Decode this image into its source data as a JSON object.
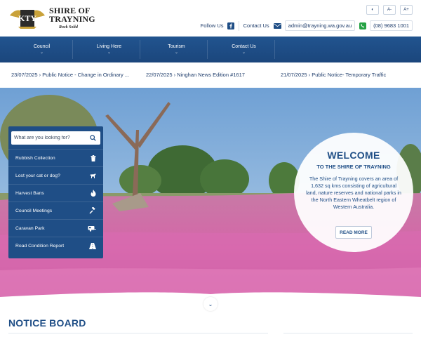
{
  "site": {
    "title_line1": "SHIRE OF",
    "title_line2": "TRAYNING",
    "motto": "Rock Solid"
  },
  "accessibility": [
    {
      "label": "◐"
    },
    {
      "label": "A-"
    },
    {
      "label": "A+"
    }
  ],
  "contact": {
    "follow_label": "Follow Us",
    "contact_label": "Contact Us",
    "email": "admin@trayning.wa.gov.au",
    "phone": "(08) 9683 1001"
  },
  "nav": [
    {
      "label": "Council"
    },
    {
      "label": "Living Here"
    },
    {
      "label": "Tourism"
    },
    {
      "label": "Contact Us"
    }
  ],
  "notices": [
    {
      "date": "23/07/2025",
      "text": "Public Notice - Change in Ordinary ..."
    },
    {
      "date": "22/07/2025",
      "text": "Ninghan News Edition #1617"
    },
    {
      "date": "21/07/2025",
      "text": "Public Notice- Temporary Traffic"
    }
  ],
  "search": {
    "placeholder": "What are you looking for?"
  },
  "quick_links": [
    {
      "label": "Rubbish Collection",
      "icon": "trash-icon"
    },
    {
      "label": "Lost your cat or dog?",
      "icon": "dog-icon"
    },
    {
      "label": "Harvest Bans",
      "icon": "fire-icon"
    },
    {
      "label": "Council Meetings",
      "icon": "gavel-icon"
    },
    {
      "label": "Caravan Park",
      "icon": "caravan-icon"
    },
    {
      "label": "Road Condition Report",
      "icon": "road-icon"
    }
  ],
  "welcome": {
    "title": "WELCOME",
    "subtitle": "TO THE SHIRE OF TRAYNING",
    "body": "The Shire of Trayning covers an area of 1,632 sq kms consisting of agricultural land, nature reserves and national parks in the North Eastern Wheatbelt region of Western Australia.",
    "button": "READ MORE"
  },
  "section": {
    "notice_board": "NOTICE BOARD"
  },
  "colors": {
    "brand": "#1f4e86",
    "accent": "#2a5da0"
  }
}
